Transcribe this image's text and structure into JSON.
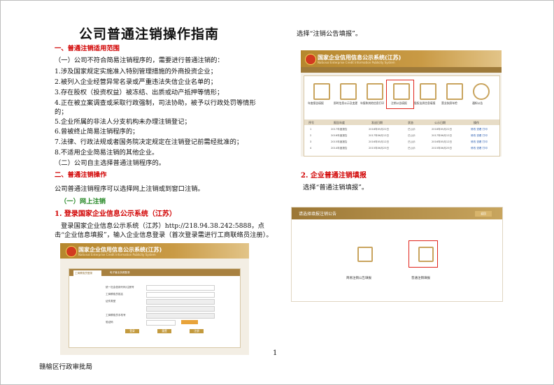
{
  "doc": {
    "title": "公司普通注销操作指南",
    "s1_heading": "一、普通注销适用范围",
    "s1_p1": "（一）公司不符合简易注销程序的，需要进行普通注销的：",
    "s1_items": [
      "1.涉及国家规定实施准入特别管理措施的外商投资企业；",
      "2.被列入企业经营异常名录或严重违法失信企业名单的；",
      "3.存在股权（投资权益）被冻结、出质或动产抵押等情形；",
      "4.正在被立案调查或采取行政强制，司法协助，被予以行政处罚等情形的；",
      "5.企业所属的非法人分支机构未办理注销登记；",
      "6.曾被终止简易注销程序的；",
      "7.法律、行政法规或者国务院决定规定在注销登记前需经批准的；",
      "8.不适用企业简易注销的其他企业。"
    ],
    "s1_p2": "（二）公司自主选择普通注销程序的。",
    "s2_heading": "二、普通注销操作",
    "s2_p1": "公司普通注销程序可以选择网上注销或到窗口注销。",
    "s2_sub": "（一）网上注销",
    "step1_heading": "1. 登录国家企业信息公示系统（江苏）",
    "step1_text": "登录国家企业信息公示系统（江苏）http://218.94.38.242:5888，点击“企业信息填报”，输入企业信息登录（首次登录需进行工商联络员注册）。",
    "right_top": "选择“注销公告填报”。",
    "step2_heading": "2. 企业普通注销填报",
    "step2_text": "选择“普通注销填报”。",
    "page_number": "1",
    "footer": "赣榆区行政审批局"
  },
  "portal": {
    "title": "国家企业信用信息公示系统(江苏)",
    "subtitle": "National Enterprise Credit Information Publicity System",
    "icons": [
      "年度报告填报",
      "即时信息公示及变更",
      "年报和其他信息打印",
      "注销公告填报",
      "股权出质信息填报",
      "营业执照年检",
      "通知公告"
    ],
    "table_headers": [
      "序号",
      "报告年度",
      "发送日期",
      "状态",
      "公示日期",
      "操作"
    ],
    "table_rows": [
      [
        "1",
        "2017年度报告",
        "2018年05月22日",
        "已公示",
        "2018年05月22日",
        "修改 查看 打印"
      ],
      [
        "2",
        "2016年度报告",
        "2017年06月12日",
        "已公示",
        "2017年06月12日",
        "修改 查看 打印"
      ],
      [
        "3",
        "2015年度报告",
        "2016年05月12日",
        "已公示",
        "2016年05月12日",
        "修改 查看 打印"
      ],
      [
        "4",
        "2014年度报告",
        "2015年06月25日",
        "已公示",
        "2015年06月25日",
        "修改 查看 打印"
      ]
    ],
    "login_tabs": [
      "工商联络员登录",
      "电子营业执照登录"
    ],
    "login_fields": [
      "统一社会信用代码/注册号",
      "工商联络员姓名",
      "证件类型",
      "工商联络员手机号",
      "验证码"
    ],
    "login_buttons": [
      "登录",
      "重置",
      "注册"
    ],
    "notice_title": "请选择填报注销公告",
    "notice_btn": "返回",
    "notice_options": [
      "简易注销公告填报",
      "普通注销填报"
    ]
  }
}
